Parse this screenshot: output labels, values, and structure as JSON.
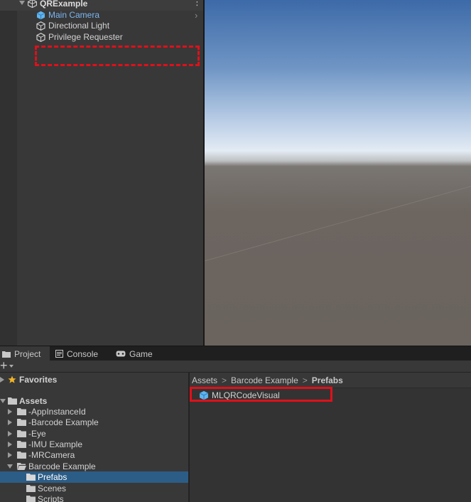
{
  "hierarchy": {
    "scene_name": "QRExample",
    "menu_glyph": "⋮",
    "chevron": "›",
    "items": [
      {
        "label": "Main Camera",
        "highlighted": true
      },
      {
        "label": "Directional Light",
        "highlighted": false
      },
      {
        "label": "Privilege Requester",
        "highlighted": false
      }
    ]
  },
  "tabs": [
    {
      "label": "Project",
      "icon": "folder-icon",
      "active": true
    },
    {
      "label": "Console",
      "icon": "console-icon",
      "active": false
    },
    {
      "label": "Game",
      "icon": "gamepad-icon",
      "active": false
    }
  ],
  "toolbar": {
    "plus_label": "+"
  },
  "project_tree": {
    "favorites": "Favorites",
    "assets": "Assets",
    "children": [
      "-AppInstanceId",
      "-Barcode Example",
      "-Eye",
      "-IMU Example",
      "-MRCamera"
    ],
    "expanded_folder": "Barcode Example",
    "subfolders": [
      {
        "label": "Prefabs",
        "selected": true
      },
      {
        "label": "Scenes",
        "selected": false
      },
      {
        "label": "Scripts",
        "selected": false
      }
    ]
  },
  "breadcrumb": {
    "items": [
      "Assets",
      "Barcode Example",
      "Prefabs"
    ],
    "separator": ">"
  },
  "asset_list": {
    "items": [
      "MLQRCodeVisual"
    ]
  },
  "colors": {
    "highlight_box": "#e0101a",
    "selection": "#2c5d87",
    "link_blue": "#7cb6f2",
    "prefab_blue": "#5fb4ee"
  }
}
